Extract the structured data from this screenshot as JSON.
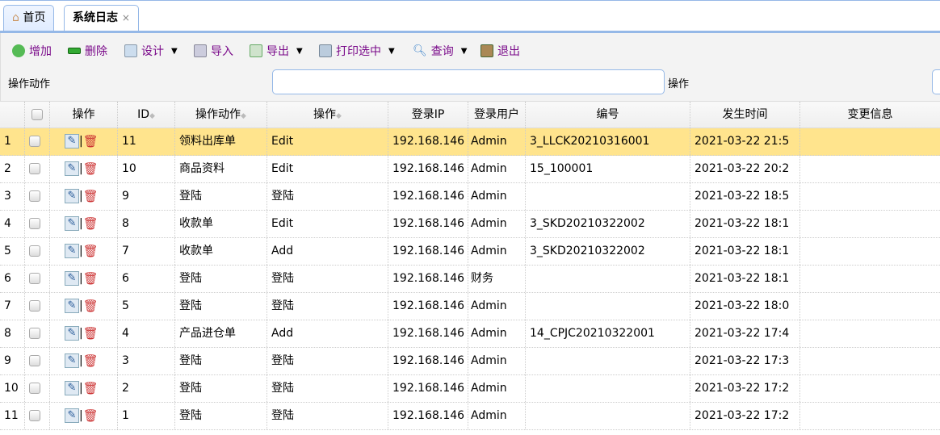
{
  "tabs": [
    {
      "label": "首页",
      "icon": "home-icon"
    },
    {
      "label": "系统日志",
      "close": "×"
    }
  ],
  "toolbar": {
    "add": "增加",
    "delete": "删除",
    "design": "设计",
    "import": "导入",
    "export": "导出",
    "print": "打印选中",
    "query": "查询",
    "exit": "退出"
  },
  "search": {
    "action_label": "操作动作",
    "action_value": "",
    "op_label": "操作",
    "op_value": ""
  },
  "columns": [
    "操作",
    "ID",
    "操作动作",
    "操作",
    "登录IP",
    "登录用户",
    "编号",
    "发生时间",
    "变更信息"
  ],
  "rows": [
    {
      "n": "1",
      "id": "11",
      "action": "领料出库单",
      "op": "Edit",
      "ip": "192.168.146",
      "user": "Admin",
      "code": "3_LLCK20210316001",
      "time": "2021-03-22 21:5"
    },
    {
      "n": "2",
      "id": "10",
      "action": "商品资料",
      "op": "Edit",
      "ip": "192.168.146",
      "user": "Admin",
      "code": "15_100001",
      "time": "2021-03-22 20:2"
    },
    {
      "n": "3",
      "id": "9",
      "action": "登陆",
      "op": "登陆",
      "ip": "192.168.146",
      "user": "Admin",
      "code": "",
      "time": "2021-03-22 18:5"
    },
    {
      "n": "4",
      "id": "8",
      "action": "收款单",
      "op": "Edit",
      "ip": "192.168.146",
      "user": "Admin",
      "code": "3_SKD20210322002",
      "time": "2021-03-22 18:1"
    },
    {
      "n": "5",
      "id": "7",
      "action": "收款单",
      "op": "Add",
      "ip": "192.168.146",
      "user": "Admin",
      "code": "3_SKD20210322002",
      "time": "2021-03-22 18:1"
    },
    {
      "n": "6",
      "id": "6",
      "action": "登陆",
      "op": "登陆",
      "ip": "192.168.146",
      "user": "财务",
      "code": "",
      "time": "2021-03-22 18:1"
    },
    {
      "n": "7",
      "id": "5",
      "action": "登陆",
      "op": "登陆",
      "ip": "192.168.146",
      "user": "Admin",
      "code": "",
      "time": "2021-03-22 18:0"
    },
    {
      "n": "8",
      "id": "4",
      "action": "产品进仓单",
      "op": "Add",
      "ip": "192.168.146",
      "user": "Admin",
      "code": "14_CPJC20210322001",
      "time": "2021-03-22 17:4"
    },
    {
      "n": "9",
      "id": "3",
      "action": "登陆",
      "op": "登陆",
      "ip": "192.168.146",
      "user": "Admin",
      "code": "",
      "time": "2021-03-22 17:3"
    },
    {
      "n": "10",
      "id": "2",
      "action": "登陆",
      "op": "登陆",
      "ip": "192.168.146",
      "user": "Admin",
      "code": "",
      "time": "2021-03-22 17:2"
    },
    {
      "n": "11",
      "id": "1",
      "action": "登陆",
      "op": "登陆",
      "ip": "192.168.146",
      "user": "Admin",
      "code": "",
      "time": "2021-03-22 17:2"
    }
  ],
  "colors": {
    "selected_row": "#ffe48d",
    "border": "#95b8e7",
    "toolbar_text": "#7a0a8a"
  }
}
